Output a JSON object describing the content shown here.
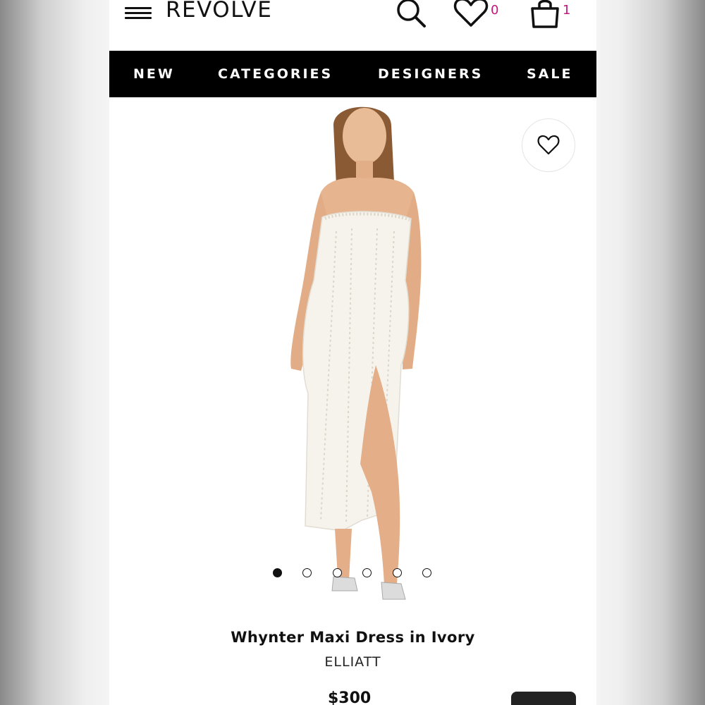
{
  "header": {
    "logo": "REVOLVE",
    "wishlist_count": "0",
    "bag_count": "1",
    "accent_color": "#c2187a"
  },
  "nav": {
    "items": [
      {
        "label": "NEW"
      },
      {
        "label": "CATEGORIES"
      },
      {
        "label": "DESIGNERS"
      },
      {
        "label": "SALE"
      }
    ]
  },
  "gallery": {
    "image_count": 6,
    "active_index": 0
  },
  "product": {
    "name": "Whynter Maxi Dress in Ivory",
    "designer": "ELLIATT",
    "price": "$300"
  },
  "icons": [
    "menu-icon",
    "search-icon",
    "heart-icon",
    "bag-icon",
    "favorite-heart-icon"
  ]
}
